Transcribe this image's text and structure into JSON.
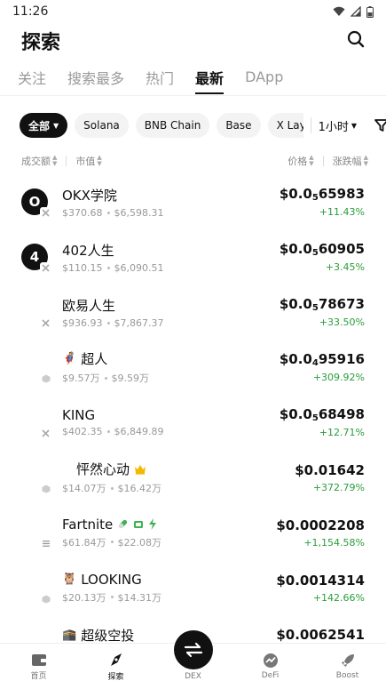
{
  "status": {
    "time": "11:26"
  },
  "header": {
    "title": "探索"
  },
  "tabs": [
    {
      "label": "关注",
      "active": false
    },
    {
      "label": "搜索最多",
      "active": false
    },
    {
      "label": "热门",
      "active": false
    },
    {
      "label": "最新",
      "active": true
    },
    {
      "label": "DApp",
      "active": false
    }
  ],
  "filters": {
    "chips": [
      "全部",
      "Solana",
      "BNB Chain",
      "Base",
      "X Layer"
    ],
    "time": "1小时"
  },
  "columns": {
    "volume": "成交额",
    "mcap": "市值",
    "price": "价格",
    "change": "涨跌幅"
  },
  "tokens": [
    {
      "name": "OKX学院",
      "avatar": "O",
      "volume": "$370.68",
      "mcap": "$6,598.31",
      "price_pre": "$0.0",
      "price_zeros": "5",
      "price_post": "65983",
      "change": "+11.43%",
      "emoji": "",
      "chain": "x"
    },
    {
      "name": "402人生",
      "avatar": "4",
      "volume": "$110.15",
      "mcap": "$6,090.51",
      "price_pre": "$0.0",
      "price_zeros": "5",
      "price_post": "60905",
      "change": "+3.45%",
      "emoji": "",
      "chain": "x"
    },
    {
      "name": "欧易人生",
      "avatar": "",
      "volume": "$936.93",
      "mcap": "$7,867.37",
      "price_pre": "$0.0",
      "price_zeros": "5",
      "price_post": "78673",
      "change": "+33.50%",
      "emoji": "",
      "chain": "x"
    },
    {
      "name": "超人",
      "avatar": "",
      "volume": "$9.57万",
      "mcap": "$9.59万",
      "price_pre": "$0.0",
      "price_zeros": "4",
      "price_post": "95916",
      "change": "+309.92%",
      "emoji": "🦸",
      "chain": "cube"
    },
    {
      "name": "KING",
      "avatar": "",
      "volume": "$402.35",
      "mcap": "$6,849.89",
      "price_pre": "$0.0",
      "price_zeros": "5",
      "price_post": "68498",
      "change": "+12.71%",
      "emoji": "",
      "chain": "x"
    },
    {
      "name": "怦然心动",
      "avatar": "",
      "volume": "$14.07万",
      "mcap": "$16.42万",
      "price_pre": "$0.01642",
      "price_zeros": "",
      "price_post": "",
      "change": "+372.79%",
      "emoji": "",
      "chain": "cube"
    },
    {
      "name": "Fartnite",
      "avatar": "",
      "volume": "$61.84万",
      "mcap": "$22.08万",
      "price_pre": "$0.0002208",
      "price_zeros": "",
      "price_post": "",
      "change": "+1,154.58%",
      "emoji": "",
      "chain": "sol"
    },
    {
      "name": "LOOKING",
      "avatar": "",
      "volume": "$20.13万",
      "mcap": "$14.31万",
      "price_pre": "$0.0014314",
      "price_zeros": "",
      "price_post": "",
      "change": "+142.66%",
      "emoji": "🦉",
      "chain": "cube"
    },
    {
      "name": "超级空投",
      "avatar": "",
      "volume": "",
      "mcap": "",
      "price_pre": "$0.0062541",
      "price_zeros": "",
      "price_post": "",
      "change": "",
      "emoji": "🕋",
      "chain": ""
    }
  ],
  "nav": [
    {
      "label": "首页",
      "icon": "wallet-icon"
    },
    {
      "label": "探索",
      "icon": "compass-icon"
    },
    {
      "label": "DEX",
      "icon": "swap-icon"
    },
    {
      "label": "DeFi",
      "icon": "defi-icon"
    },
    {
      "label": "Boost",
      "icon": "rocket-icon"
    }
  ],
  "colors": {
    "up": "#2a9d3a",
    "crown": "#f5b800",
    "pill": "#3fb24f"
  }
}
